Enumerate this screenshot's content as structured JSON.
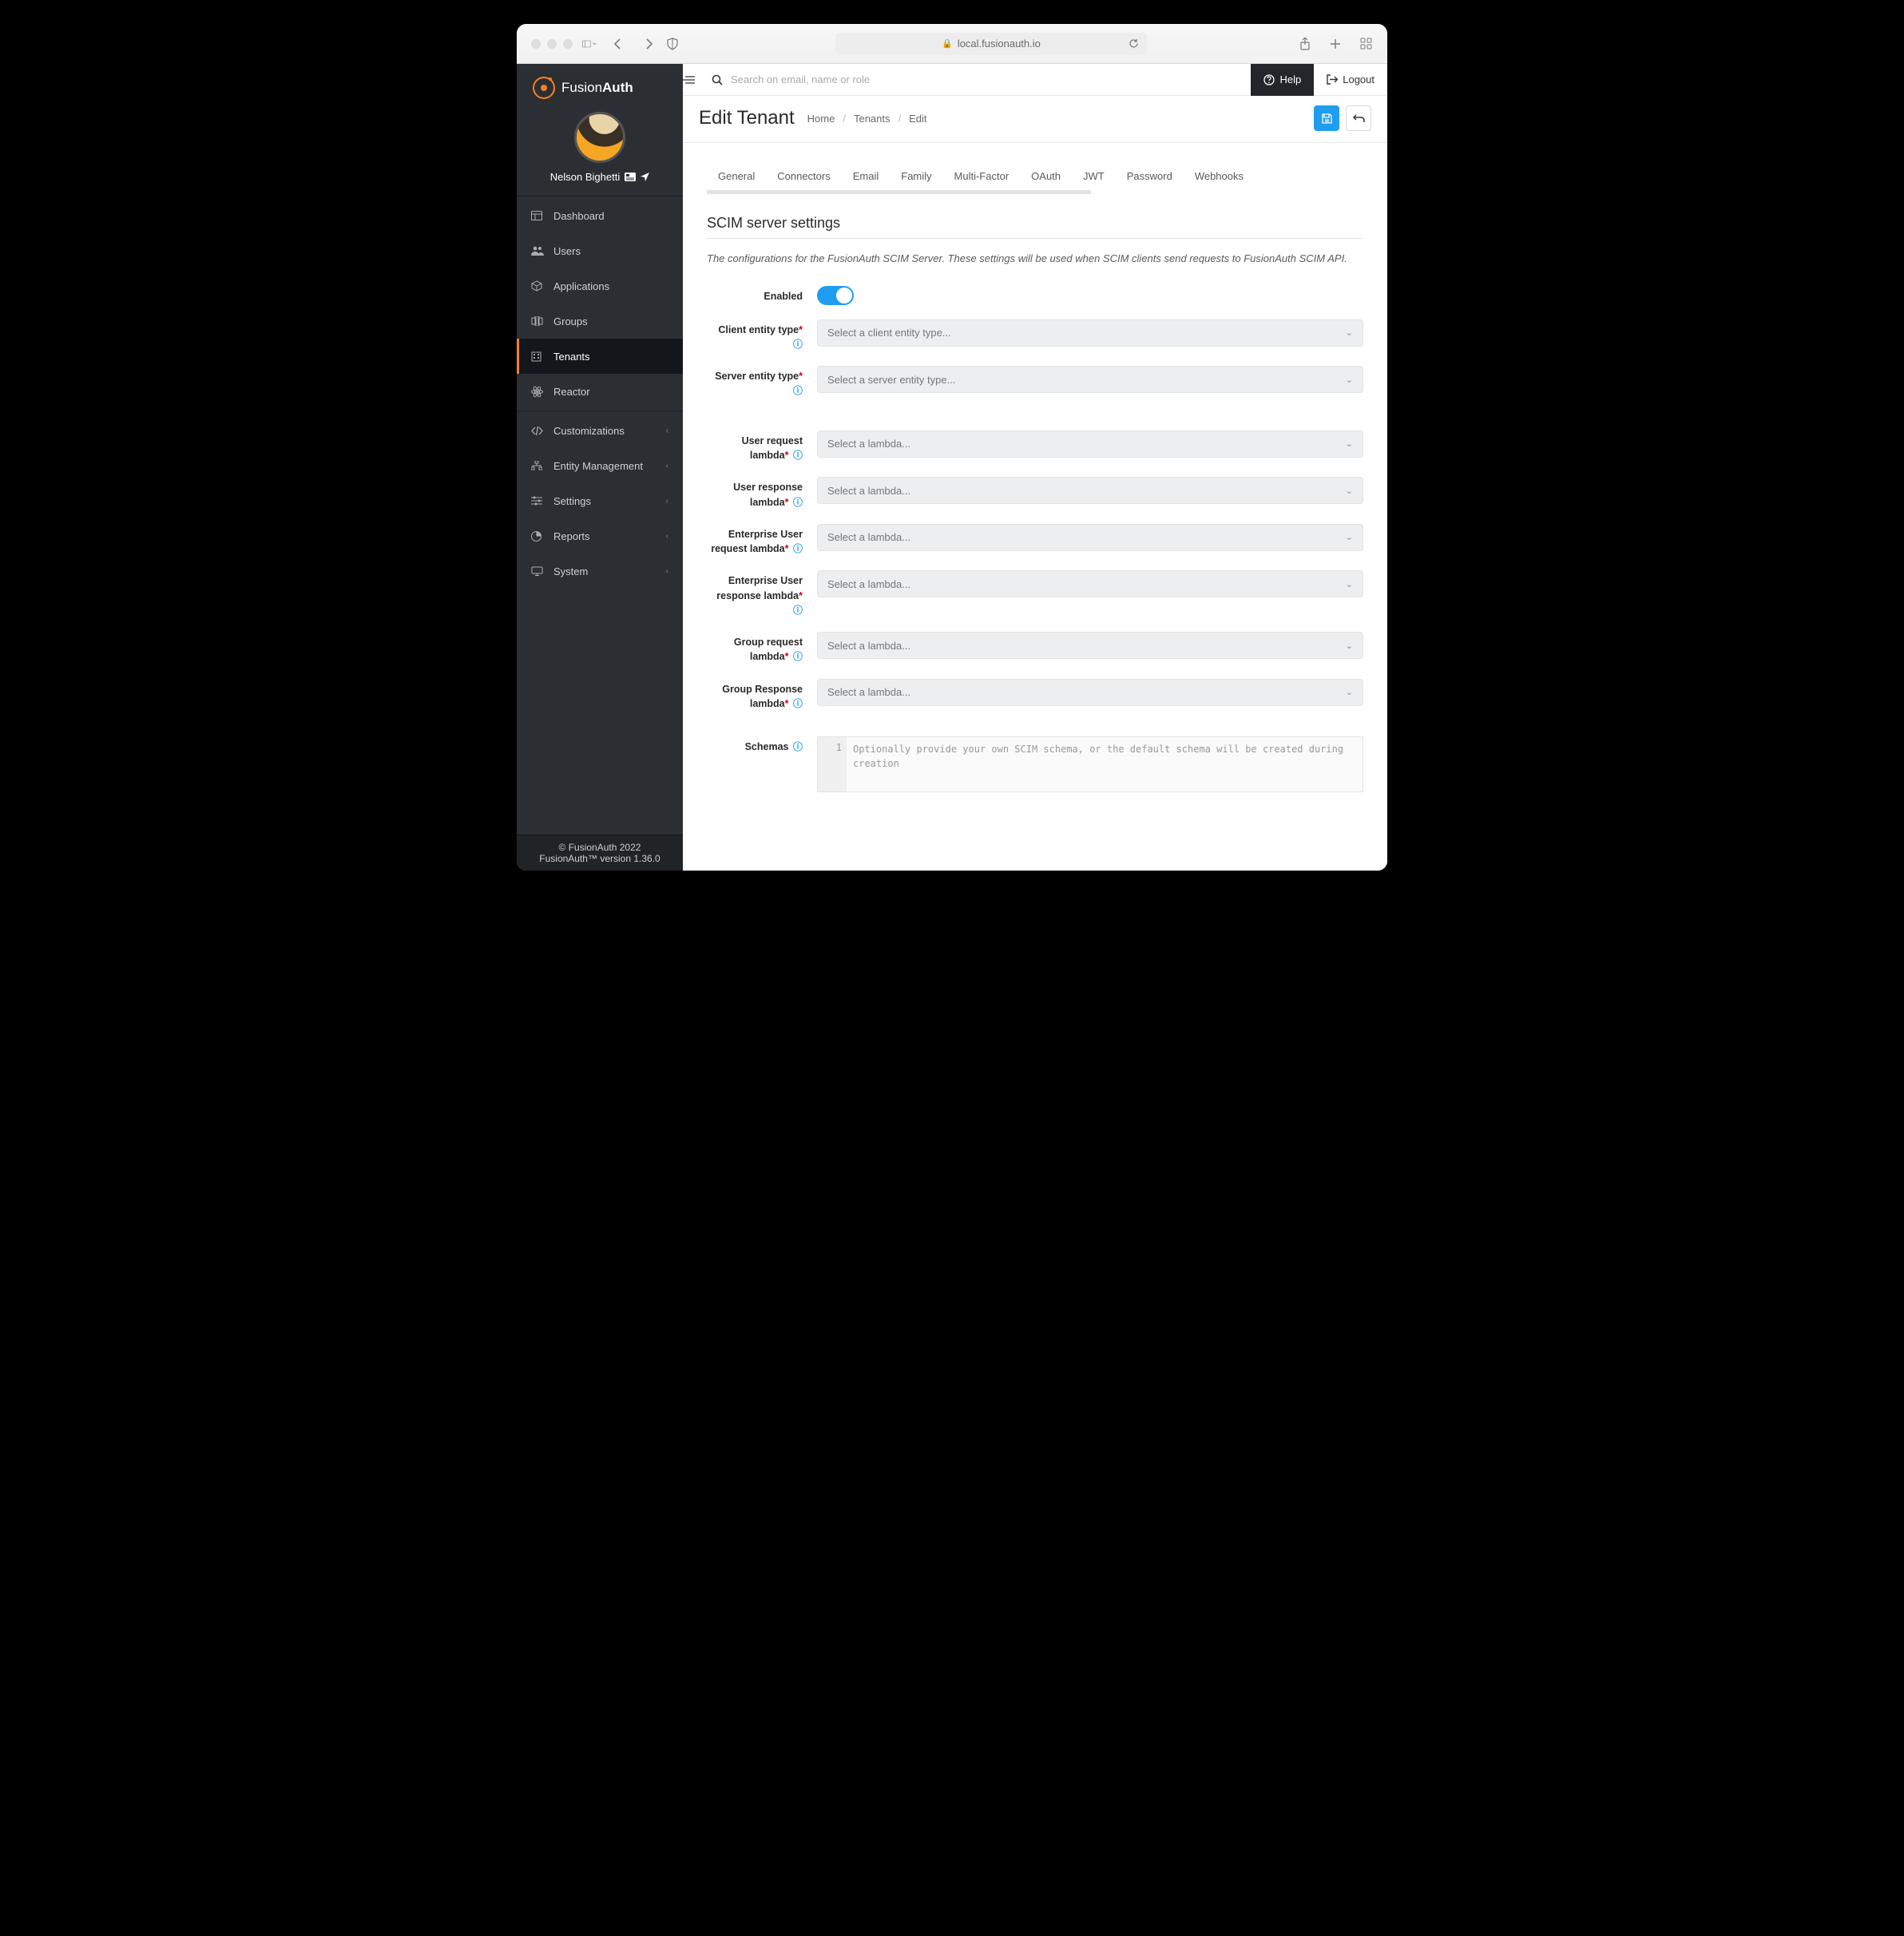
{
  "browser": {
    "url": "local.fusionauth.io"
  },
  "brand": {
    "name_light": "Fusion",
    "name_bold": "Auth"
  },
  "user": {
    "name": "Nelson Bighetti"
  },
  "nav": {
    "items": [
      {
        "label": "Dashboard"
      },
      {
        "label": "Users"
      },
      {
        "label": "Applications"
      },
      {
        "label": "Groups"
      },
      {
        "label": "Tenants"
      },
      {
        "label": "Reactor"
      }
    ],
    "expandable": [
      {
        "label": "Customizations"
      },
      {
        "label": "Entity Management"
      },
      {
        "label": "Settings"
      },
      {
        "label": "Reports"
      },
      {
        "label": "System"
      }
    ]
  },
  "footer": {
    "copyright": "© FusionAuth 2022",
    "version": "FusionAuth™ version 1.36.0"
  },
  "toolbar": {
    "search_placeholder": "Search on email, name or role",
    "help": "Help",
    "logout": "Logout"
  },
  "page": {
    "title": "Edit Tenant"
  },
  "breadcrumb": {
    "home": "Home",
    "tenants": "Tenants",
    "edit": "Edit"
  },
  "tabs": [
    "General",
    "Connectors",
    "Email",
    "Family",
    "Multi-Factor",
    "OAuth",
    "JWT",
    "Password",
    "Webhooks"
  ],
  "section": {
    "title": "SCIM server settings",
    "desc": "The configurations for the FusionAuth SCIM Server. These settings will be used when SCIM clients send requests to FusionAuth SCIM API."
  },
  "form": {
    "enabled": {
      "label": "Enabled"
    },
    "client_entity": {
      "label": "Client entity type",
      "placeholder": "Select a client entity type..."
    },
    "server_entity": {
      "label": "Server entity type",
      "placeholder": "Select a server entity type..."
    },
    "user_req": {
      "label": "User request lambda",
      "placeholder": "Select a lambda..."
    },
    "user_res": {
      "label": "User response lambda",
      "placeholder": "Select a lambda..."
    },
    "ent_user_req": {
      "label": "Enterprise User request lambda",
      "placeholder": "Select a lambda..."
    },
    "ent_user_res": {
      "label": "Enterprise User response lambda",
      "placeholder": "Select a lambda..."
    },
    "group_req": {
      "label": "Group request lambda",
      "placeholder": "Select a lambda..."
    },
    "group_res": {
      "label": "Group Response lambda",
      "placeholder": "Select a lambda..."
    },
    "schemas": {
      "label": "Schemas",
      "placeholder": "Optionally provide your own SCIM schema, or the default schema will be created during creation",
      "line": "1"
    }
  }
}
